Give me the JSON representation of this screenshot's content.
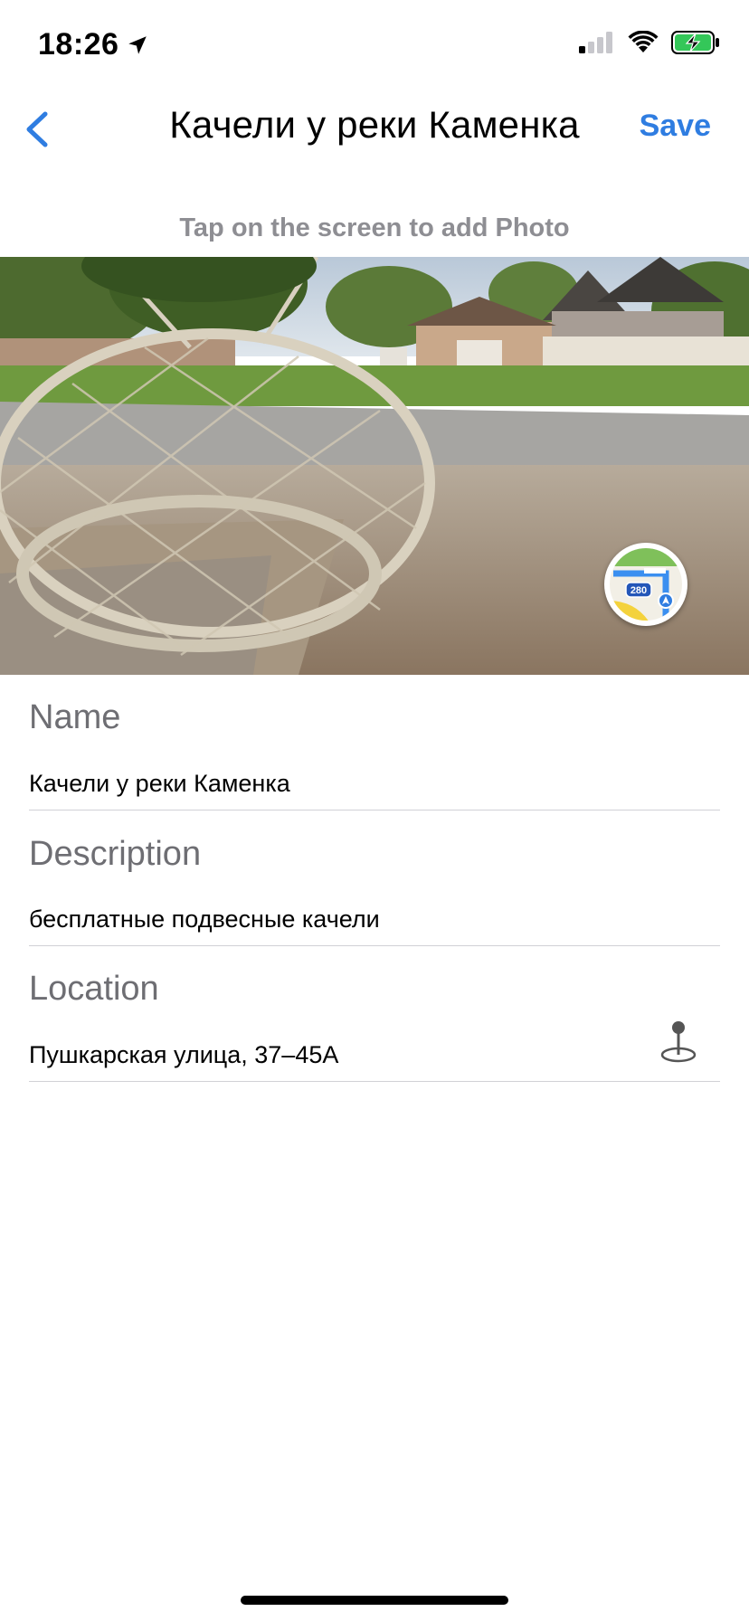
{
  "status_bar": {
    "time": "18:26"
  },
  "nav": {
    "title": "Качели у реки Каменка",
    "save_label": "Save"
  },
  "photo": {
    "hint": "Tap on the screen to add Photo",
    "maps_badge_number": "280"
  },
  "form": {
    "name": {
      "label": "Name",
      "value": "Качели у реки Каменка"
    },
    "description": {
      "label": "Description",
      "value": "бесплатные подвесные качели"
    },
    "location": {
      "label": "Location",
      "value": "Пушкарская улица, 37–45А"
    }
  },
  "colors": {
    "accent": "#2f7de1",
    "label_gray": "#6e6e73",
    "hint_gray": "#8e8e93",
    "battery_green": "#34c759"
  }
}
